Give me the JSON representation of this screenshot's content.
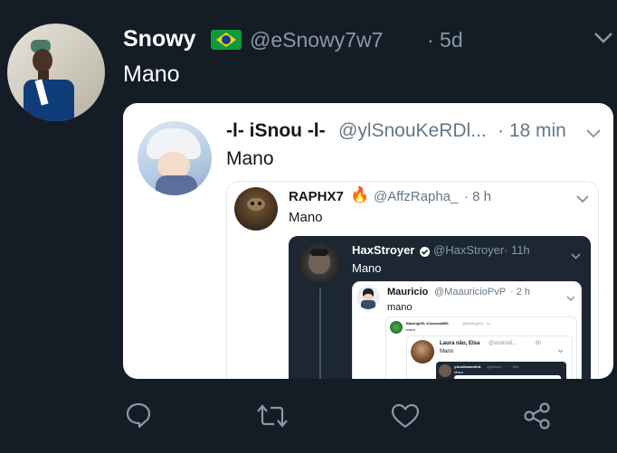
{
  "tweet": {
    "name": "Snowy",
    "flag": "🇧🇷",
    "handle": "@eSnowy7w7",
    "time": "· 5d",
    "text": "Mano"
  },
  "quote1": {
    "name": "-l- iSnou -l-",
    "handle": "@ylSnouKeRDl...",
    "time": "· 18 min",
    "text": "Mano"
  },
  "quote2": {
    "name": "RAPHX7",
    "emoji": "🔥",
    "handle": "@AffzRapha_",
    "time": "· 8 h",
    "text": "Mano"
  },
  "quote3": {
    "name": "HaxStroyer",
    "handle": "@HaxStroyer",
    "time": "· 11h",
    "text": "Mano"
  },
  "quote4": {
    "name": "Mauricio",
    "handle": "@MaauricioPvP",
    "time": "· 2 h",
    "text": "mano"
  },
  "quote5": {
    "name": "Blazing051 #CarnavalBS",
    "handle": "@blazing051",
    "time": "· 1h",
    "text": "mano"
  },
  "quote6": {
    "name": "Laura não, Elsa",
    "handle": "@android...",
    "time": "· 8h",
    "text": "Mano"
  },
  "quote7": {
    "name": "yAnaSamanthA",
    "handle": "@yAnaS...",
    "time": "· 30s",
    "text": "Mano"
  },
  "colors": {
    "background": "#141d26",
    "accent": "#1da1f2",
    "muted": "#8899a6"
  },
  "actions": [
    "reply-icon",
    "retweet-icon",
    "like-icon",
    "share-icon"
  ]
}
